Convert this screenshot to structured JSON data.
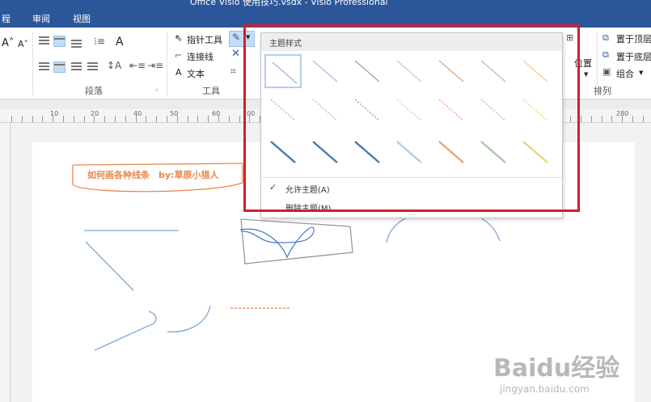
{
  "window": {
    "title": "Office Visio 使用技巧.vsdx - Visio Professional"
  },
  "tabs": [
    "程",
    "审阅",
    "视图"
  ],
  "ribbon": {
    "tools": {
      "pointer": "指针工具",
      "connector": "连接线",
      "text": "文本"
    },
    "groups": {
      "paragraph": "段落",
      "tools": "工具",
      "arrange": "排列"
    },
    "arrange": {
      "position": "位置",
      "bring_front": "置于顶层",
      "send_back": "置于底层",
      "group": "组合"
    }
  },
  "ruler": {
    "labels": [
      "10",
      "20",
      "40",
      "50",
      "60",
      "100",
      "280",
      "300"
    ]
  },
  "dropdown": {
    "header": "主题样式",
    "allow_theme": "允许主题(A)",
    "remove_theme": "删除主题(M)",
    "swatch_colors": [
      "#9bb7d8",
      "#a8bdd4",
      "#8fa2bb",
      "#b9cde0",
      "#e8a37a",
      "#a9c79a",
      "#f0d27a"
    ],
    "swatch_rows": [
      {
        "style": "solid-thin"
      },
      {
        "style": "dashed"
      },
      {
        "style": "solid-thick"
      }
    ]
  },
  "drawing": {
    "title_shape_text": "如何画各种线条　by:草原小猎人",
    "accent": "#e8874a"
  },
  "watermark": {
    "brand": "Baidu经验",
    "url": "jingyan.baidu.com"
  },
  "colors": {
    "highlight_box": "#d0202a",
    "ribbon_blue": "#2b579a"
  }
}
